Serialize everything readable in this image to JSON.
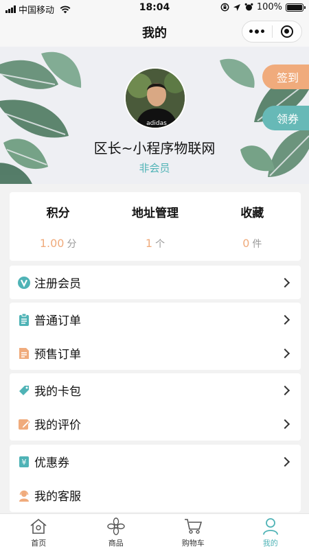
{
  "status_bar": {
    "carrier": "中国移动",
    "time": "18:04",
    "battery": "100%",
    "battery_level": 1.0
  },
  "nav": {
    "title": "我的"
  },
  "profile": {
    "name": "区长~小程序物联网",
    "member_status": "非会员",
    "sign_in_label": "签到",
    "get_coupon_label": "领券",
    "shirt_text": "adidas"
  },
  "stats": [
    {
      "label": "积分",
      "value": "1.00",
      "unit": "分"
    },
    {
      "label": "地址管理",
      "value": "1",
      "unit": "个"
    },
    {
      "label": "收藏",
      "value": "0",
      "unit": "件"
    }
  ],
  "menu": {
    "register_member": "注册会员",
    "normal_orders": "普通订单",
    "presale_orders": "预售订单",
    "card_wallet": "我的卡包",
    "my_reviews": "我的评价",
    "coupons": "优惠券",
    "customer_service": "我的客服"
  },
  "icons": {
    "member": "member-v-icon",
    "order": "clipboard-icon",
    "presale": "document-icon",
    "card": "tag-icon",
    "review": "edit-icon",
    "coupon": "yen-coupon-icon",
    "service": "headset-user-icon"
  },
  "colors": {
    "teal": "#4fb3b6",
    "orange": "#f0ab7c"
  },
  "tabbar": [
    {
      "label": "首页",
      "active": false
    },
    {
      "label": "商品",
      "active": false
    },
    {
      "label": "购物车",
      "active": false
    },
    {
      "label": "我的",
      "active": true
    }
  ]
}
